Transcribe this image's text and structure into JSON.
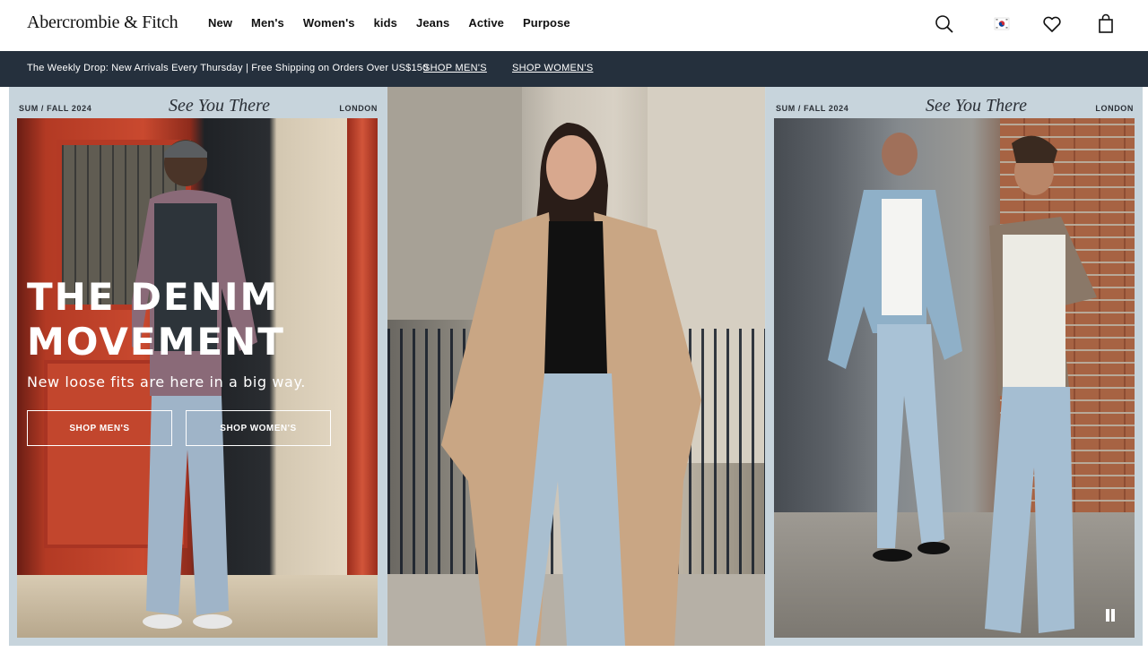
{
  "header": {
    "logo": "Abercrombie & Fitch",
    "nav": [
      "New",
      "Men's",
      "Women's",
      "kids",
      "Jeans",
      "Active",
      "Purpose"
    ],
    "icons": [
      "search-icon",
      "flag-icon",
      "heart-icon",
      "bag-icon"
    ]
  },
  "promo": {
    "text": "The Weekly Drop: New Arrivals Every Thursday | Free Shipping on Orders Over US$150",
    "shop_mens": "SHOP MEN'S",
    "shop_womens": "SHOP WOMEN'S"
  },
  "hero": {
    "left": {
      "season": "SUM / FALL 2024",
      "tagline": "See You There",
      "city": "LONDON"
    },
    "right": {
      "season": "SUM / FALL 2024",
      "tagline": "See You There",
      "city": "LONDON"
    },
    "headline_1": "THE DENIM",
    "headline_2": "MOVEMENT",
    "subhead": "New loose fits are here in a big way.",
    "cta_mens": "SHOP MEN'S",
    "cta_womens": "SHOP WOMEN'S"
  },
  "colors": {
    "promo_bg": "#25303d",
    "hero_frame": "#c9d6de",
    "text_dark": "#111111"
  }
}
